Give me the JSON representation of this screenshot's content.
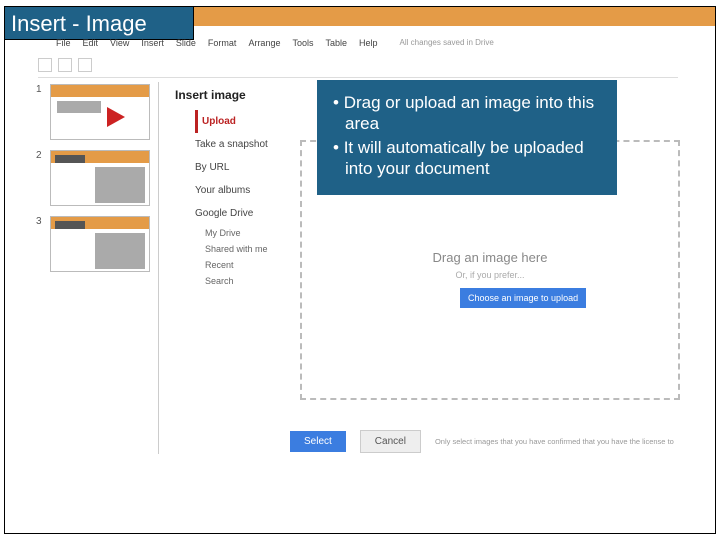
{
  "title": "Insert - Image",
  "menu": {
    "file": "File",
    "edit": "Edit",
    "view": "View",
    "insert": "Insert",
    "slide": "Slide",
    "format": "Format",
    "arrange": "Arrange",
    "tools": "Tools",
    "table": "Table",
    "help": "Help",
    "status": "All changes saved in Drive"
  },
  "thumbs": {
    "n1": "1",
    "n2": "2",
    "n3": "3"
  },
  "modal": {
    "title": "Insert image",
    "sidebar": {
      "upload": "Upload",
      "snapshot": "Take a snapshot",
      "byurl": "By URL",
      "albums": "Your albums",
      "drive": "Google Drive",
      "mydrive": "My Drive",
      "shared": "Shared with me",
      "recent": "Recent",
      "search": "Search"
    },
    "dropzone": {
      "drag": "Drag an image here",
      "or": "Or, if you prefer...",
      "choose": "Choose an image to upload"
    },
    "select": "Select",
    "cancel": "Cancel",
    "disclaimer": "Only select images that you have confirmed that you have the license to"
  },
  "callout": {
    "b1": "Drag or upload an image into this area",
    "b2": "It will automatically be uploaded into your document"
  }
}
